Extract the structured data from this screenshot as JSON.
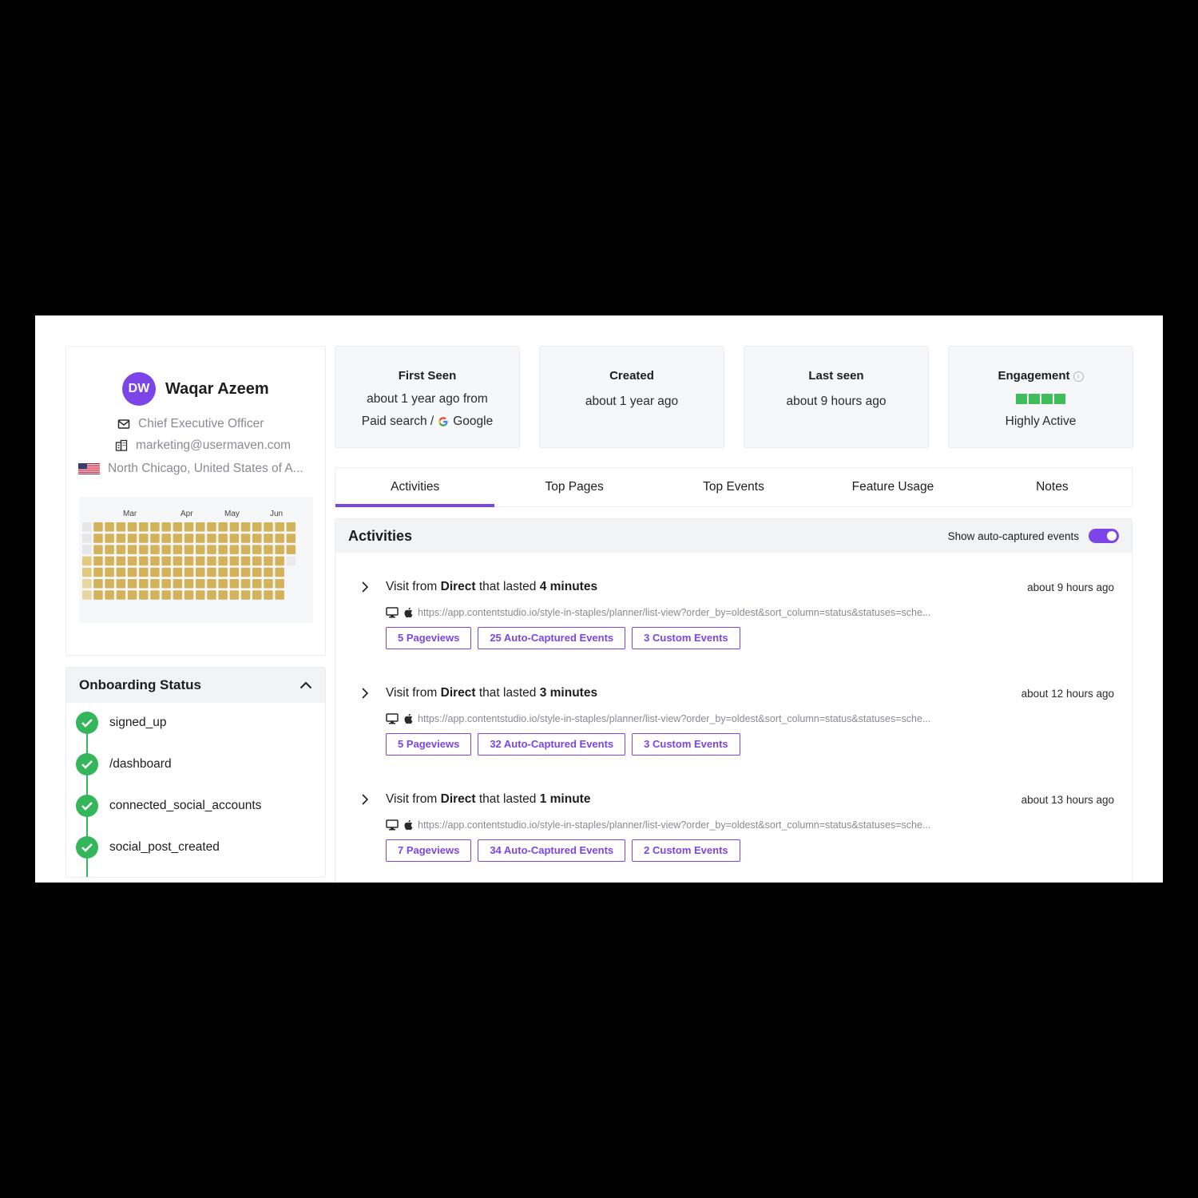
{
  "profile": {
    "initials": "DW",
    "name": "Waqar Azeem",
    "title": "Chief Executive Officer",
    "email": "marketing@usermaven.com",
    "location": "North Chicago, United States of A...",
    "icons": [
      "mail-icon",
      "company-icon",
      "us-flag-icon"
    ],
    "heatmap_months": [
      "Mar",
      "Apr",
      "May",
      "Jun"
    ],
    "heatmap_color": "#d4b25a"
  },
  "onboarding": {
    "title": "Onboarding Status",
    "steps": [
      "signed_up",
      "/dashboard",
      "connected_social_accounts",
      "social_post_created"
    ],
    "color": "#34b65a"
  },
  "stats": {
    "first_seen": {
      "title": "First Seen",
      "line1": "about 1 year ago from",
      "line2_prefix": "Paid search /",
      "line2_source": "Google"
    },
    "created": {
      "title": "Created",
      "value": "about 1 year ago"
    },
    "last_seen": {
      "title": "Last seen",
      "value": "about 9 hours ago"
    },
    "engagement": {
      "title": "Engagement",
      "value": "Highly Active",
      "level": 4,
      "max": 4,
      "color": "#3ebd5a"
    }
  },
  "tabs": [
    "Activities",
    "Top Pages",
    "Top Events",
    "Feature Usage",
    "Notes"
  ],
  "activities": {
    "title": "Activities",
    "toggle_label": "Show auto-captured events",
    "toggle_on": true,
    "accent": "#7b45e8",
    "visits": [
      {
        "prefix": "Visit from",
        "source": "Direct",
        "mid": "that lasted",
        "duration": "4 minutes",
        "time": "about 9 hours ago",
        "url": "https://app.contentstudio.io/style-in-staples/planner/list-view?order_by=oldest&sort_column=status&statuses=sche...",
        "chips": [
          "5 Pageviews",
          "25 Auto-Captured Events",
          "3 Custom Events"
        ]
      },
      {
        "prefix": "Visit from",
        "source": "Direct",
        "mid": "that lasted",
        "duration": "3 minutes",
        "time": "about 12 hours ago",
        "url": "https://app.contentstudio.io/style-in-staples/planner/list-view?order_by=oldest&sort_column=status&statuses=sche...",
        "chips": [
          "5 Pageviews",
          "32 Auto-Captured Events",
          "3 Custom Events"
        ]
      },
      {
        "prefix": "Visit from",
        "source": "Direct",
        "mid": "that lasted",
        "duration": "1 minute",
        "time": "about 13 hours ago",
        "url": "https://app.contentstudio.io/style-in-staples/planner/list-view?order_by=oldest&sort_column=status&statuses=sche...",
        "chips": [
          "7 Pageviews",
          "34 Auto-Captured Events",
          "2 Custom Events"
        ]
      }
    ]
  }
}
